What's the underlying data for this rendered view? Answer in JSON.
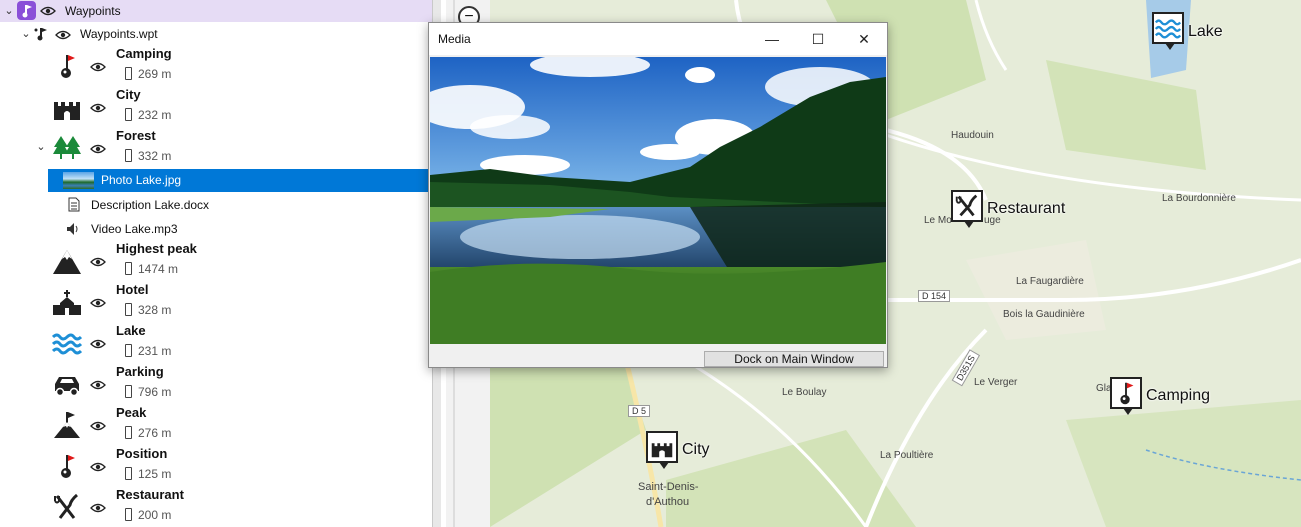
{
  "tree": {
    "root": {
      "label": "Waypoints"
    },
    "file": {
      "label": "Waypoints.wpt"
    },
    "waypoints": [
      {
        "name": "Camping",
        "elevation": "269 m",
        "icon": "camping-flag-icon"
      },
      {
        "name": "City",
        "elevation": "232 m",
        "icon": "castle-icon"
      },
      {
        "name": "Forest",
        "elevation": "332 m",
        "icon": "trees-icon"
      },
      {
        "name": "Highest peak",
        "elevation": "1474 m",
        "icon": "mountain-icon"
      },
      {
        "name": "Hotel",
        "elevation": "328 m",
        "icon": "hotel-icon"
      },
      {
        "name": "Lake",
        "elevation": "231 m",
        "icon": "waves-icon"
      },
      {
        "name": "Parking",
        "elevation": "796 m",
        "icon": "car-icon"
      },
      {
        "name": "Peak",
        "elevation": "276 m",
        "icon": "peak-flag-icon"
      },
      {
        "name": "Position",
        "elevation": "125 m",
        "icon": "position-flag-icon"
      },
      {
        "name": "Restaurant",
        "elevation": "200 m",
        "icon": "fork-knife-icon"
      }
    ],
    "attachments": [
      {
        "label": "Photo Lake.jpg",
        "icon": "photo-thumbnail-icon"
      },
      {
        "label": "Description Lake.docx",
        "icon": "document-icon"
      },
      {
        "label": "Video Lake.mp3",
        "icon": "speaker-icon"
      }
    ]
  },
  "media_window": {
    "title": "Media",
    "minimize": "—",
    "maximize": "☐",
    "close": "✕",
    "dock_label": "Dock on Main Window"
  },
  "map": {
    "places": [
      "Haudouin",
      "Le Mo",
      "uge",
      "La Bourdonnière",
      "La Faugardière",
      "Bois la Gaudinière",
      "Le Verger",
      "Le Boulay",
      "Gla",
      "La Poultière",
      "Saint-Denis-",
      "d'Authou"
    ],
    "roads": [
      "D 154",
      "D 5",
      "D351S"
    ],
    "markers": [
      "Lake",
      "Restaurant",
      "Camping",
      "City"
    ],
    "zoom_out": "−"
  },
  "colors": {
    "selection": "#0078d7",
    "root_bg": "#e6dcf5",
    "waypoint_icon": "#222222",
    "lake_icon": "#1e8fd6",
    "forest_icon": "#1b8a3a"
  }
}
